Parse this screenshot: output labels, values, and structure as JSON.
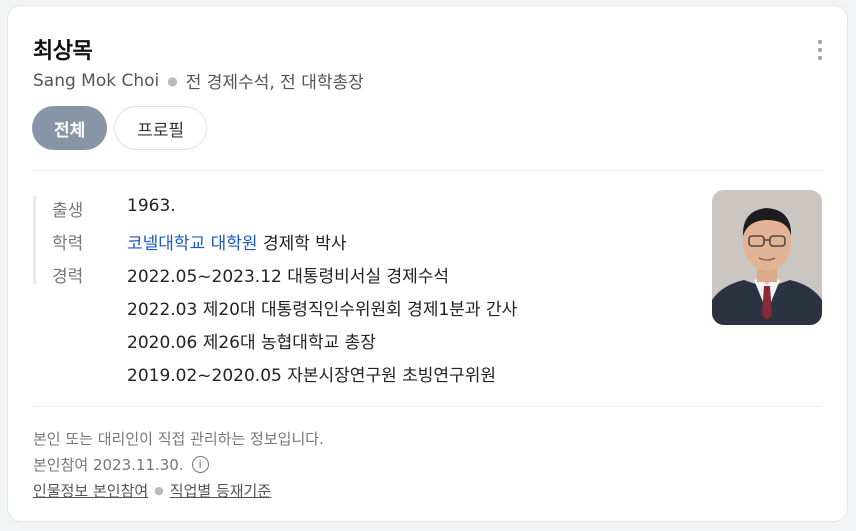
{
  "profile": {
    "name": "최상목",
    "english_name": "Sang Mok Choi",
    "description": "전 경제수석, 전 대학총장"
  },
  "tabs": [
    {
      "label": "전체",
      "active": true
    },
    {
      "label": "프로필",
      "active": false
    }
  ],
  "details": {
    "birth_label": "출생",
    "birth_value": "1963.",
    "education_label": "학력",
    "education_school": "코넬대학교 대학원",
    "education_degree": "경제학 박사",
    "career_label": "경력",
    "career": [
      "2022.05~2023.12 대통령비서실 경제수석",
      "2022.03 제20대 대통령직인수위원회 경제1분과 간사",
      "2020.06 제26대 농협대학교 총장",
      "2019.02~2020.05 자본시장연구원 초빙연구위원"
    ]
  },
  "footer": {
    "notice": "본인 또는 대리인이 직접 관리하는 정보입니다.",
    "date": "본인참여 2023.11.30.",
    "link1": "인물정보 본인참여",
    "link2": "직업별 등재기준"
  },
  "colors": {
    "active_tab": "#8795a4",
    "link": "#1b57c7"
  }
}
